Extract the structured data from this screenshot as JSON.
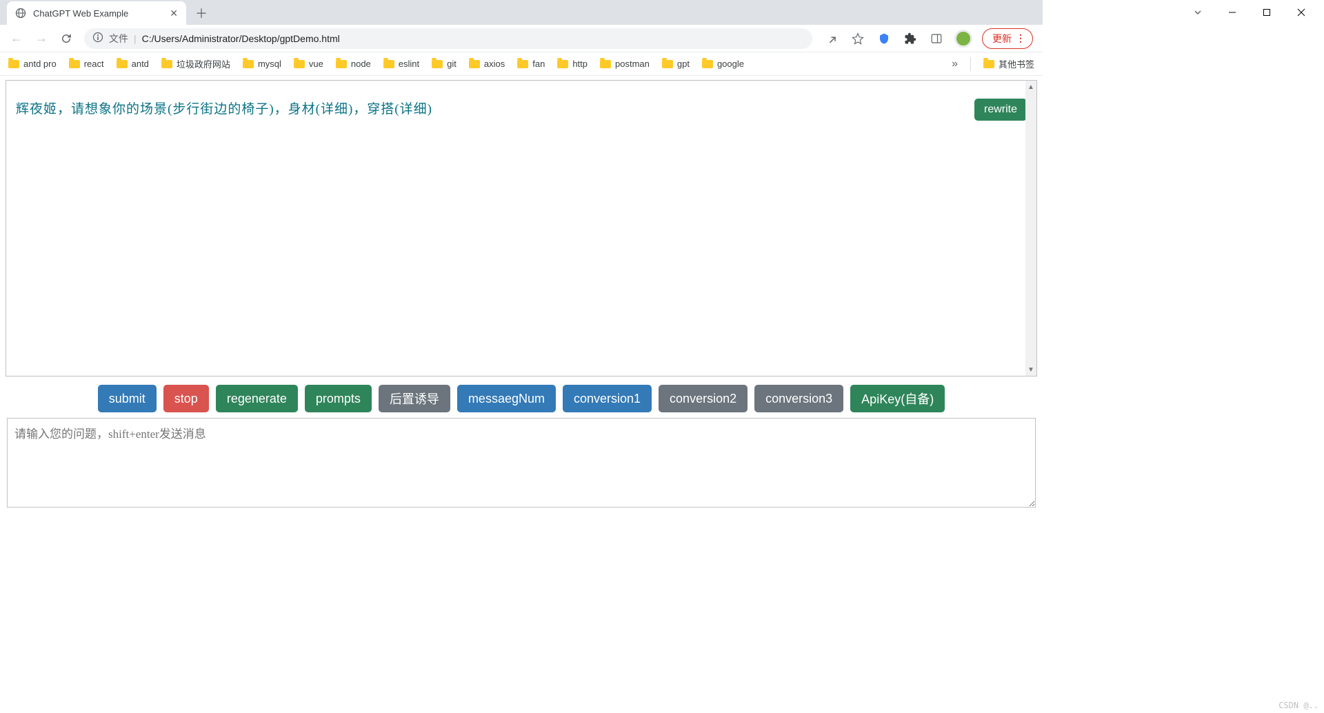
{
  "tab": {
    "title": "ChatGPT Web Example"
  },
  "address": {
    "scheme_label": "文件",
    "url": "C:/Users/Administrator/Desktop/gptDemo.html"
  },
  "update_button": "更新",
  "bookmarks": [
    "antd pro",
    "react",
    "antd",
    "垃圾政府网站",
    "mysql",
    "vue",
    "node",
    "eslint",
    "git",
    "axios",
    "fan",
    "http",
    "postman",
    "gpt",
    "google"
  ],
  "other_bookmarks": "其他书签",
  "chat": {
    "user_msg": "辉夜姬，请想象你的场景(步行街边的椅子)，身材(详细)，穿搭(详细)",
    "rewrite": "rewrite"
  },
  "actions": {
    "submit": "submit",
    "stop": "stop",
    "regenerate": "regenerate",
    "prompts": "prompts",
    "post_induce": "后置诱导",
    "message_num": "messaegNum",
    "conversion1": "conversion1",
    "conversion2": "conversion2",
    "conversion3": "conversion3",
    "apikey": "ApiKey(自备)"
  },
  "input": {
    "placeholder": "请输入您的问题，shift+enter发送消息"
  },
  "watermark": "CSDN @.."
}
